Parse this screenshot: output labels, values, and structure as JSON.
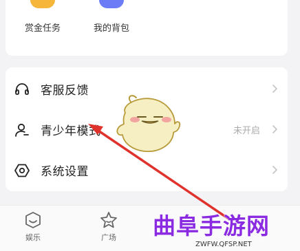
{
  "top_grid": {
    "items": [
      {
        "label": "赏金任务",
        "color": "#f6b63a"
      },
      {
        "label": "我的背包",
        "color": "#6b7cf6"
      }
    ]
  },
  "menu": {
    "items": [
      {
        "label": "客服反馈",
        "icon": "headset-icon",
        "value": ""
      },
      {
        "label": "青少年模式",
        "icon": "user-icon",
        "value": "未开启"
      },
      {
        "label": "系统设置",
        "icon": "settings-icon",
        "value": ""
      }
    ]
  },
  "tabbar": {
    "tabs": [
      {
        "label": "娱乐",
        "icon": "smile-icon"
      },
      {
        "label": "广场",
        "icon": "star-icon"
      }
    ]
  },
  "watermark": {
    "title": "曲阜手游网",
    "url": "ZWFW.QFSP.NET"
  },
  "colors": {
    "arrow": "#e0322c",
    "background": "#f3f3f5",
    "watermark": "#8a2be2"
  }
}
